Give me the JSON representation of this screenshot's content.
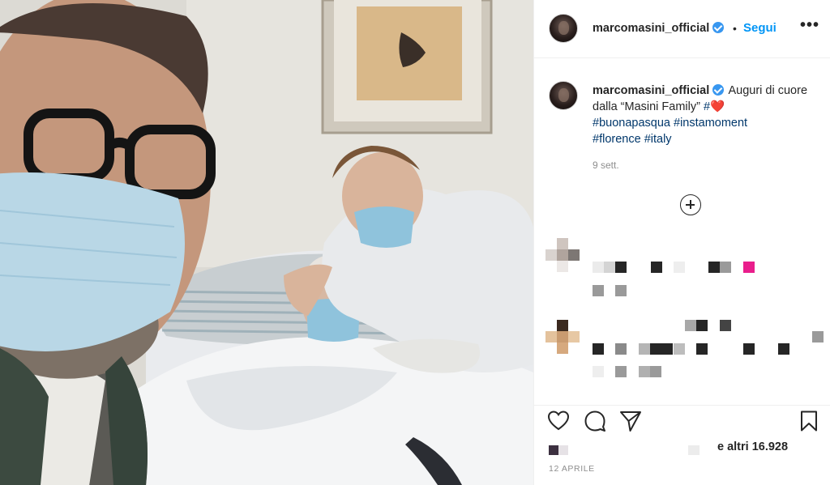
{
  "post": {
    "username": "marcomasini_official",
    "verified": true,
    "follow_label": "Segui",
    "more_icon": "more-options-icon",
    "caption": {
      "username": "marcomasini_official",
      "text": "Auguri di cuore dalla “Masini Family”",
      "hash": "#",
      "heart": "❤️",
      "hashtags": [
        "#buonapasqua",
        "#instamoment",
        "#florence",
        "#italy"
      ],
      "time_ago": "9 sett."
    },
    "load_more_icon": "plus-circle-icon",
    "likes_text": "e altri 16.928",
    "date": "12 APRILE",
    "accent_color": "#0095f6",
    "hashtag_color": "#00376b"
  }
}
